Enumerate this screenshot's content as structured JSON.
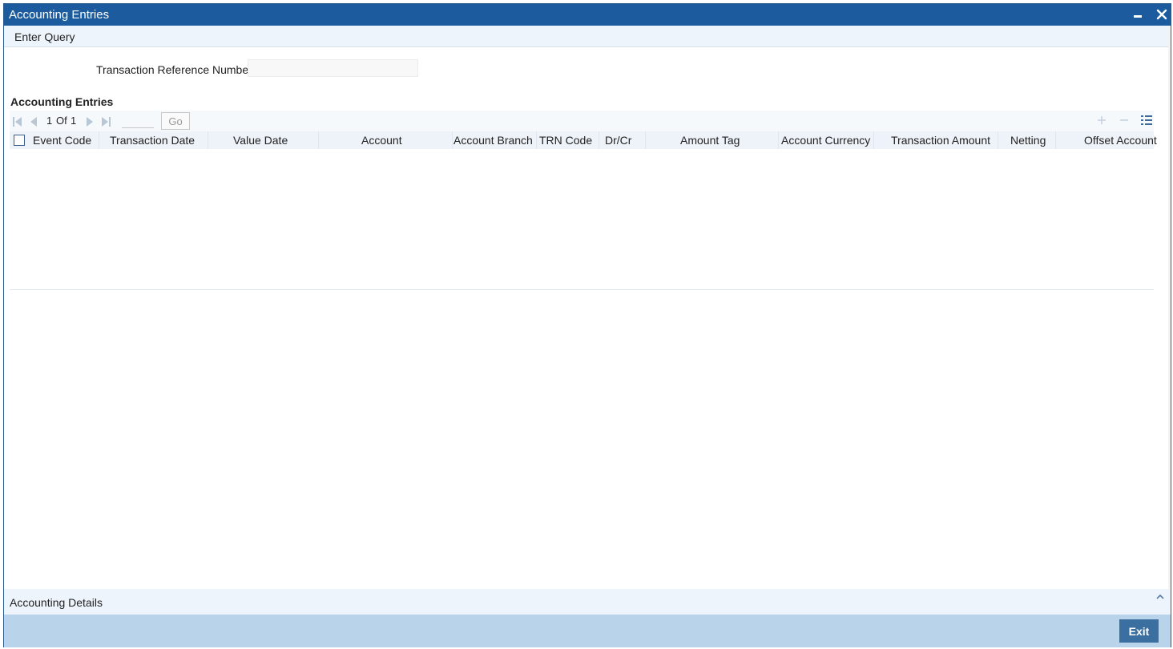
{
  "window": {
    "title": "Accounting Entries"
  },
  "menu": {
    "enter_query": "Enter Query"
  },
  "form": {
    "txn_ref_label": "Transaction Reference Number",
    "txn_ref_value": ""
  },
  "section": {
    "title": "Accounting Entries"
  },
  "pager": {
    "current": "1",
    "of_label": "Of",
    "total": "1",
    "page_input_value": "",
    "go_label": "Go"
  },
  "grid": {
    "columns": [
      "Event Code",
      "Transaction Date",
      "Value Date",
      "Account",
      "Account Branch",
      "TRN Code",
      "Dr/Cr",
      "Amount Tag",
      "Account Currency",
      "Transaction Amount",
      "Netting",
      "Offset Account"
    ],
    "rows": []
  },
  "details": {
    "label": "Accounting Details"
  },
  "footer": {
    "exit_label": "Exit"
  },
  "colors": {
    "titlebar": "#1c5c9e",
    "menubar": "#eef4fb",
    "footer": "#b9d3ea",
    "exit_button": "#3a6fa0",
    "pager_icon": "#b8c6d6"
  }
}
